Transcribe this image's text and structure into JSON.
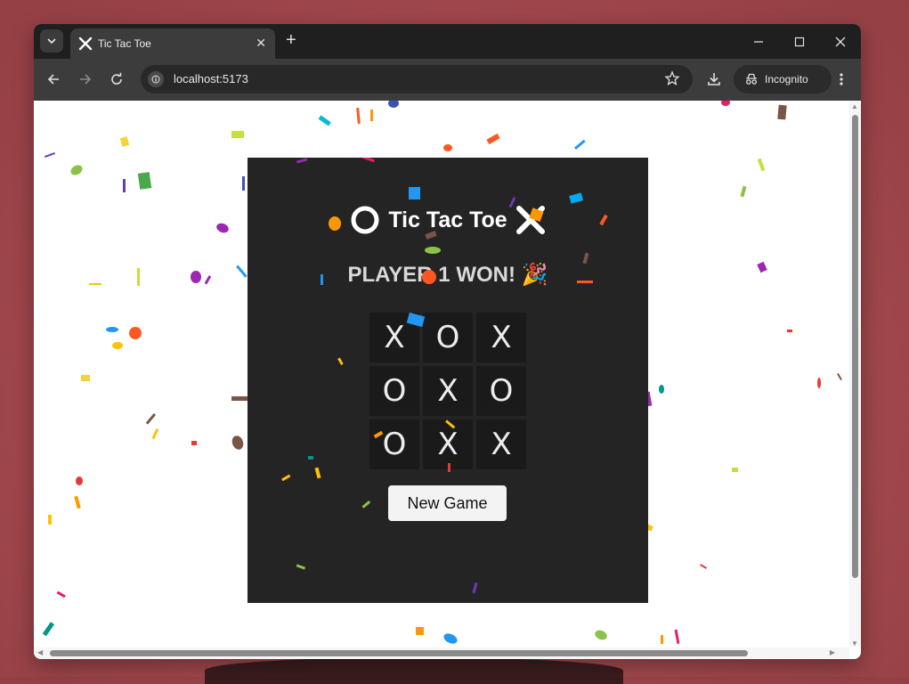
{
  "browser": {
    "tab_title": "Tic Tac Toe",
    "url": "localhost:5173",
    "incognito_label": "Incognito"
  },
  "game": {
    "title": "Tic Tac Toe",
    "status": "PLAYER 1 WON! 🎉",
    "board": [
      [
        "X",
        "O",
        "X"
      ],
      [
        "O",
        "X",
        "O"
      ],
      [
        "O",
        "X",
        "X"
      ]
    ],
    "new_game_label": "New Game"
  },
  "colors": {
    "page_bg": "#ffffff",
    "game_bg": "#242424",
    "cell_bg": "#1a1a1a",
    "browser_chrome": "#3c3c3c"
  }
}
